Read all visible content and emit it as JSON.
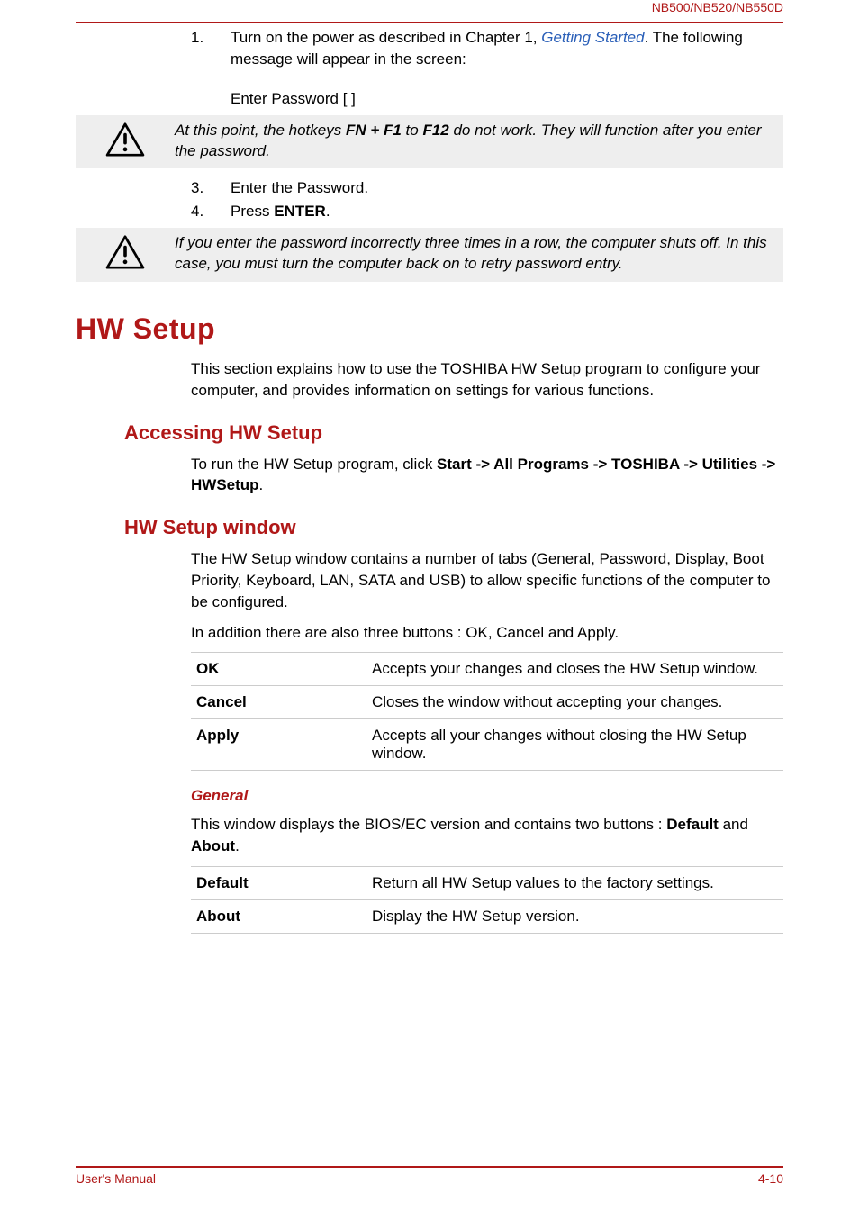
{
  "header": {
    "model": "NB500/NB520/NB550D"
  },
  "intro": {
    "items": [
      {
        "num": "1.",
        "pre": "Turn on the power as described in Chapter 1, ",
        "link": "Getting Started",
        "post": ". The following message will appear in the screen:"
      }
    ],
    "passwordPrompt": "Enter Password [ ]"
  },
  "callout1": {
    "pre": "At this point, the hotkeys ",
    "b1": "FN + F1",
    "mid": " to ",
    "b2": "F12",
    "post": " do not work. They will function after you enter the password."
  },
  "steps2": [
    {
      "num": "3.",
      "text": "Enter the Password."
    },
    {
      "num": "4.",
      "pre": "Press ",
      "b": "ENTER",
      "post": "."
    }
  ],
  "callout2": "If you enter the password incorrectly three times in a row, the computer shuts off. In this case, you must turn the computer back on to retry password entry.",
  "hwsetup": {
    "title": "HW Setup",
    "intro": "This section explains how to use the TOSHIBA HW Setup program to configure your computer, and provides information on settings for various functions.",
    "accessing": {
      "title": "Accessing HW Setup",
      "p_pre": "To run the HW Setup program, click ",
      "p_b": "Start -> All Programs -> TOSHIBA -> Utilities -> HWSetup",
      "p_post": "."
    },
    "window": {
      "title": "HW Setup window",
      "p1": "The HW Setup window contains a number of tabs (General, Password, Display, Boot Priority, Keyboard, LAN, SATA and USB) to allow specific functions of the computer to be configured.",
      "p2": "In addition there are also three buttons : OK, Cancel and Apply.",
      "rows": [
        {
          "term": "OK",
          "def": "Accepts your changes and closes the HW Setup window."
        },
        {
          "term": "Cancel",
          "def": "Closes the window without accepting your changes."
        },
        {
          "term": "Apply",
          "def": "Accepts all your changes without closing the HW Setup window."
        }
      ]
    },
    "general": {
      "title": "General",
      "p_pre": "This window displays the BIOS/EC version and contains two buttons : ",
      "p_b1": "Default",
      "p_mid": " and ",
      "p_b2": "About",
      "p_post": ".",
      "rows": [
        {
          "term": "Default",
          "def": "Return all HW Setup values to the factory settings."
        },
        {
          "term": "About",
          "def": "Display the HW Setup version."
        }
      ]
    }
  },
  "footer": {
    "left": "User's Manual",
    "right": "4-10"
  }
}
